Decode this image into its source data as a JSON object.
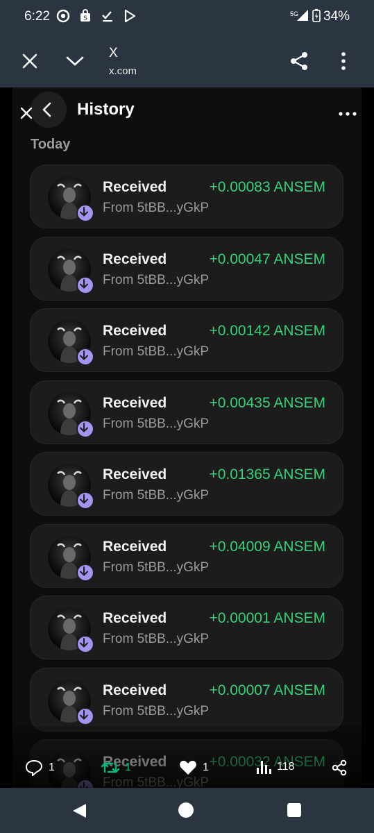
{
  "status_bar": {
    "time": "6:22",
    "network": "5G",
    "battery": "34%"
  },
  "browser": {
    "title": "X",
    "url": "x.com"
  },
  "wallet": {
    "header_title": "History",
    "section_label": "Today",
    "transactions": [
      {
        "label": "Received",
        "from": "From 5tBB...yGkP",
        "amount": "+0.00083 ANSEM"
      },
      {
        "label": "Received",
        "from": "From 5tBB...yGkP",
        "amount": "+0.00047 ANSEM"
      },
      {
        "label": "Received",
        "from": "From 5tBB...yGkP",
        "amount": "+0.00142 ANSEM"
      },
      {
        "label": "Received",
        "from": "From 5tBB...yGkP",
        "amount": "+0.00435 ANSEM"
      },
      {
        "label": "Received",
        "from": "From 5tBB...yGkP",
        "amount": "+0.01365 ANSEM"
      },
      {
        "label": "Received",
        "from": "From 5tBB...yGkP",
        "amount": "+0.04009 ANSEM"
      },
      {
        "label": "Received",
        "from": "From 5tBB...yGkP",
        "amount": "+0.00001 ANSEM"
      },
      {
        "label": "Received",
        "from": "From 5tBB...yGkP",
        "amount": "+0.00007 ANSEM"
      },
      {
        "label": "Received",
        "from": "From 5tBB...yGkP",
        "amount": "+0.00032 ANSEM"
      }
    ]
  },
  "post_actions": {
    "replies": "1",
    "reposts": "1",
    "likes": "1",
    "views": "118"
  },
  "colors": {
    "amount_green": "#36d27a",
    "badge_purple": "#a394f0",
    "repost_green": "#00ba7c",
    "chrome": "#2b3541"
  },
  "icons": [
    "close-icon",
    "chevron-down-icon",
    "share-icon",
    "more-vert-icon",
    "back-icon",
    "more-horiz-icon",
    "arrow-down-icon",
    "reply-icon",
    "repost-icon",
    "heart-icon",
    "views-icon"
  ]
}
